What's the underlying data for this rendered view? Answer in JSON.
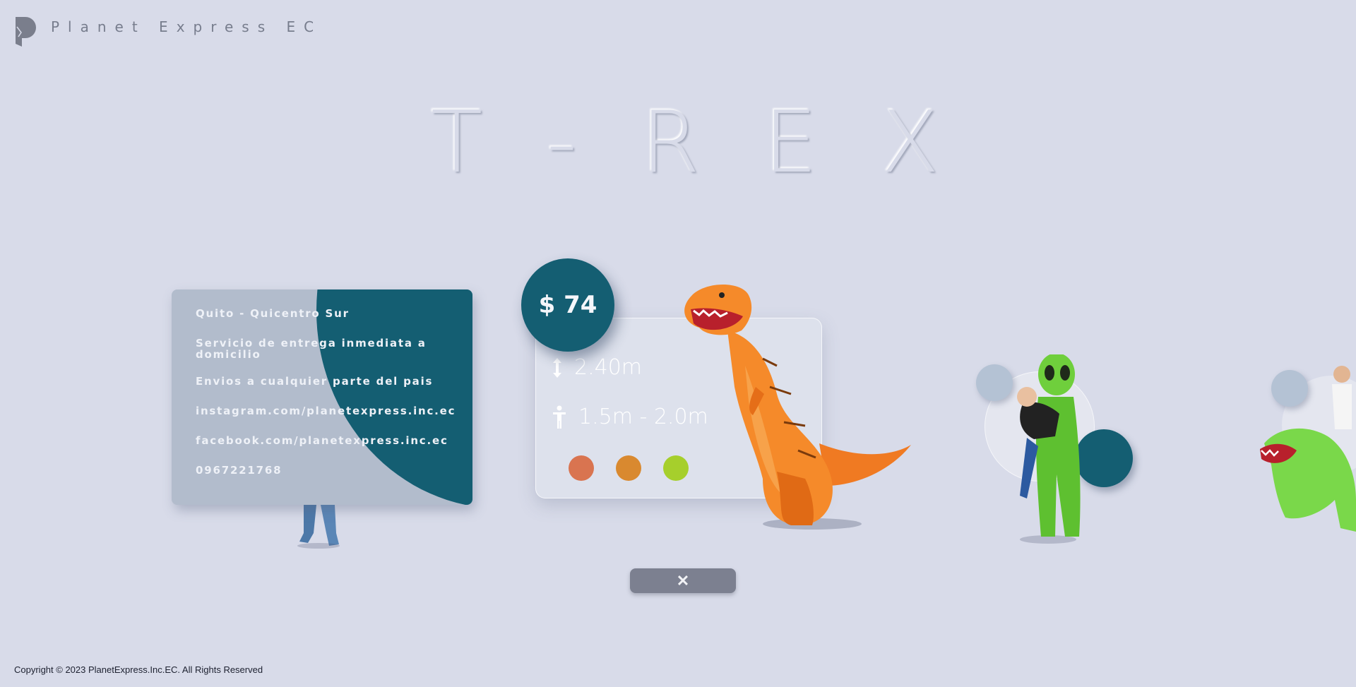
{
  "header": {
    "brand": "Planet Express EC",
    "logo_icon": "planet-express-logo-icon"
  },
  "hero": {
    "title_letters": [
      "T",
      "-",
      "R",
      "E",
      "X"
    ]
  },
  "info_card": {
    "lines": [
      "Quito - Quicentro Sur",
      "Servicio de entrega inmediata a domicilio",
      "Envios a cualquier parte del pais",
      "instagram.com/planetexpress.inc.ec",
      "facebook.com/planetexpress.inc.ec",
      "0967221768"
    ],
    "accent_color": "#145e72"
  },
  "product": {
    "price": "$ 74",
    "height": "2.40m",
    "person_height": "1.5m - 2.0m",
    "height_icon": "vertical-arrows-icon",
    "person_icon": "person-icon",
    "colors": [
      "#d97450",
      "#d9892f",
      "#a6cf2c"
    ]
  },
  "controls": {
    "close_label": "✕"
  },
  "footer": {
    "copyright": "Copyright © 2023 PlanetExpress.Inc.EC. All Rights Reserved"
  }
}
